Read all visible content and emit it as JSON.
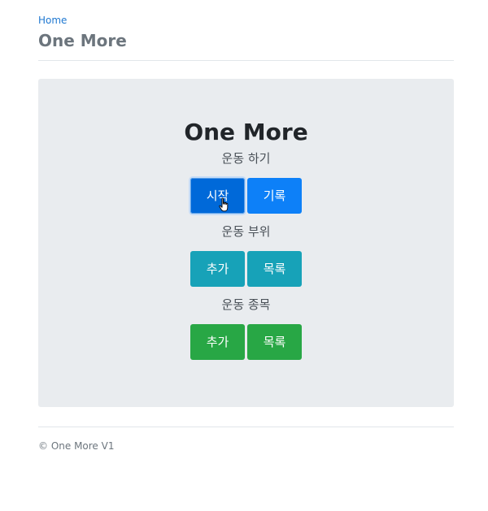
{
  "header": {
    "breadcrumb": "Home",
    "title": "One More"
  },
  "jumbotron": {
    "title": "One More",
    "sections": [
      {
        "label": "운동 하기",
        "buttons": [
          "시작",
          "기록"
        ]
      },
      {
        "label": "운동 부위",
        "buttons": [
          "추가",
          "목록"
        ]
      },
      {
        "label": "운동 종목",
        "buttons": [
          "추가",
          "목록"
        ]
      }
    ]
  },
  "footer": {
    "text": "© One More V1"
  },
  "colors": {
    "primary": "#0d80f8",
    "primary_active": "#0069d9",
    "info": "#17a2b8",
    "success": "#28a745",
    "link": "#1f78d1"
  }
}
